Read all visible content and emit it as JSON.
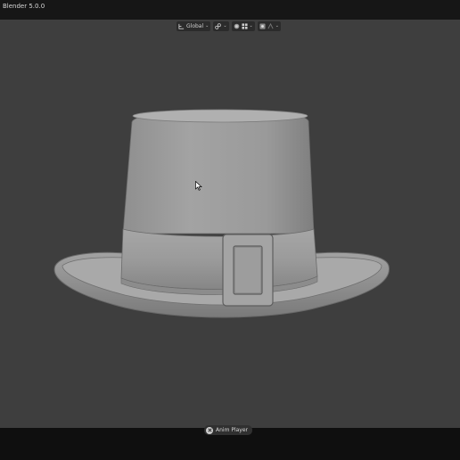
{
  "app": {
    "title": "Blender 5.0.0"
  },
  "viewport_header": {
    "transform_orientation": "Global",
    "icons": [
      "transform-pivot-icon",
      "snap-link-icon",
      "proportional-edit-icon",
      "grid-icon",
      "overlay-icon",
      "gizmo-icon"
    ]
  },
  "status": {
    "anim_player_label": "Anim Player"
  },
  "colors": {
    "viewport_bg": "#3e3e3e",
    "titlebar_bg": "#161616",
    "model_base": "#9a9a9a"
  }
}
